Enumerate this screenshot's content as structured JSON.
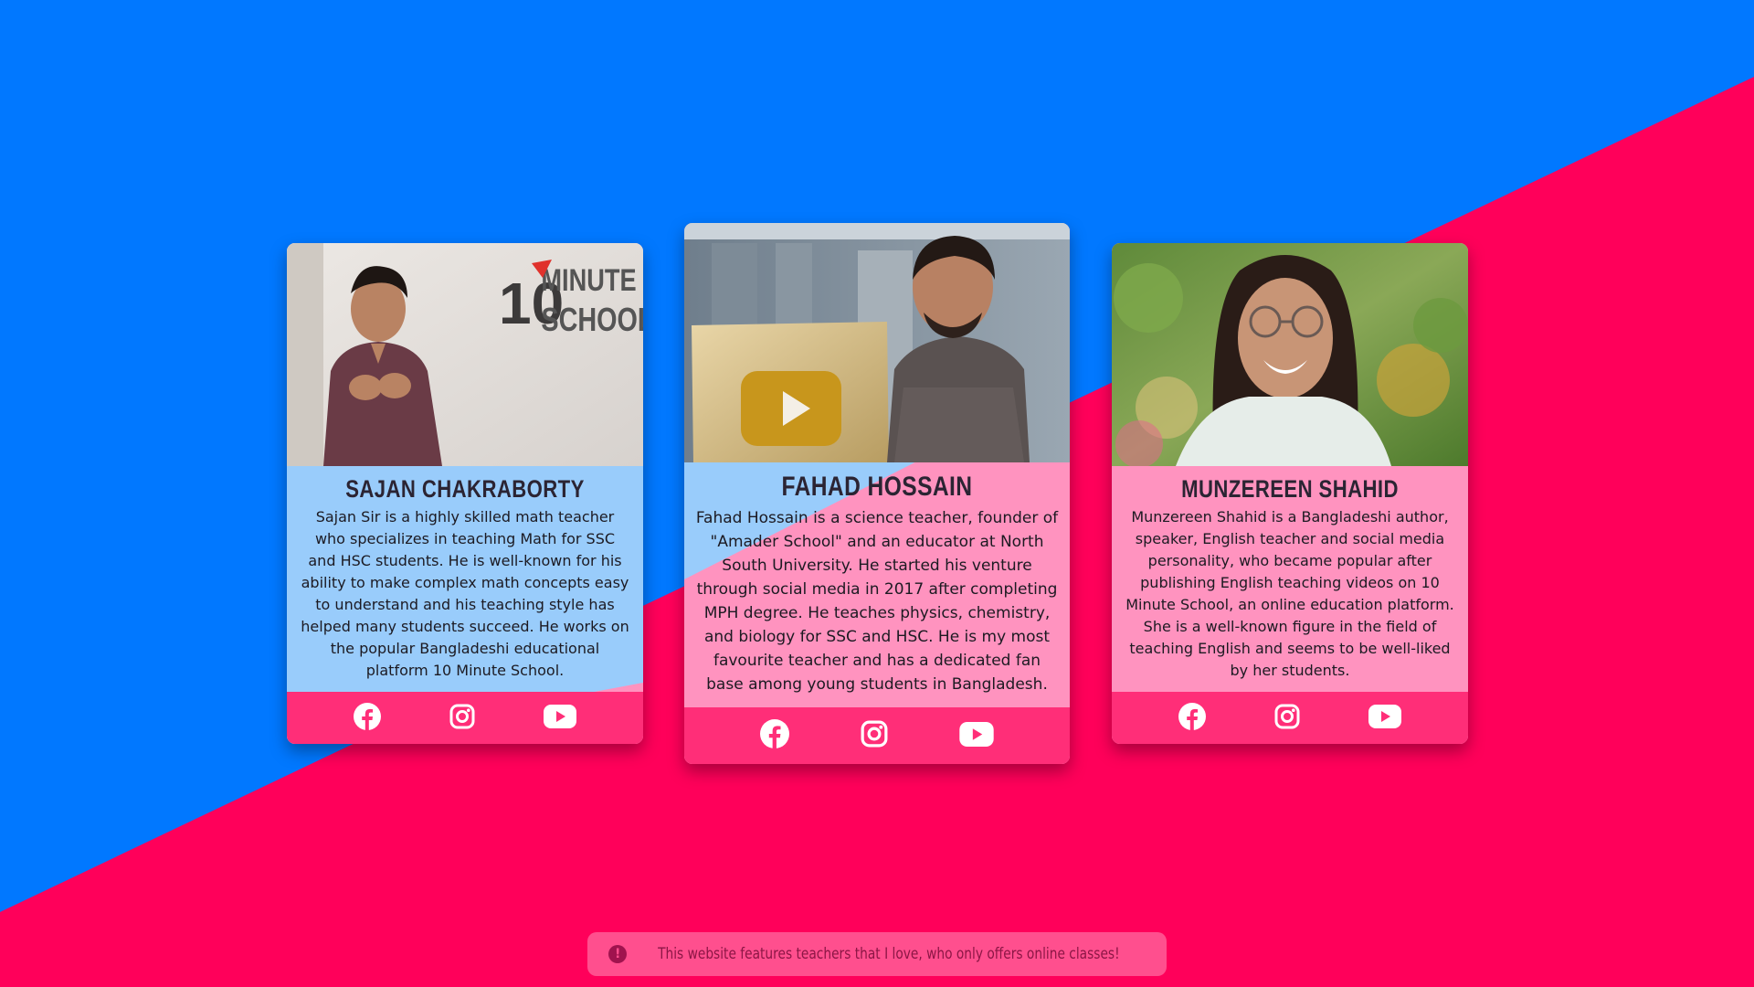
{
  "colors": {
    "background_blue": "#0178ff",
    "background_pink": "#ff005a",
    "card_blue_tint": "#99ccfb",
    "card_pink_tint": "#ff93bf",
    "footer_pink": "#ff2e78"
  },
  "teachers": [
    {
      "name": "SAJAN CHAKRABORTY",
      "bio": "Sajan Sir is a highly skilled math teacher who specializes in teaching Math for SSC and HSC students. He is well-known for his ability to make complex math concepts easy to understand and his teaching style has helped many students succeed. He works on the popular Bangladeshi educational platform 10 Minute School.",
      "photo_logo_text": "10 MINUTE SCHOOL",
      "social": [
        "facebook-icon",
        "instagram-icon",
        "youtube-icon"
      ]
    },
    {
      "name": "FAHAD HOSSAIN",
      "bio": "Fahad Hossain is a science teacher, founder of \"Amader School\" and an educator at North South University. He started his venture through social media in 2017 after completing MPH degree. He teaches physics, chemistry, and biology for SSC and HSC. He is my most favourite teacher and has a dedicated fan base among young students in Bangladesh.",
      "social": [
        "facebook-icon",
        "instagram-icon",
        "youtube-icon"
      ]
    },
    {
      "name": "MUNZEREEN SHAHID",
      "bio": "Munzereen Shahid is a Bangladeshi author, speaker, English teacher and social media personality, who became popular after publishing English teaching videos on 10 Minute School, an online education platform. She is a well-known figure in the field of teaching English and seems to be well-liked by her students.",
      "social": [
        "facebook-icon",
        "instagram-icon",
        "youtube-icon"
      ]
    }
  ],
  "notice": {
    "icon": "alert-circle-icon",
    "text": "This website features teachers that I love, who only offers online classes!"
  }
}
